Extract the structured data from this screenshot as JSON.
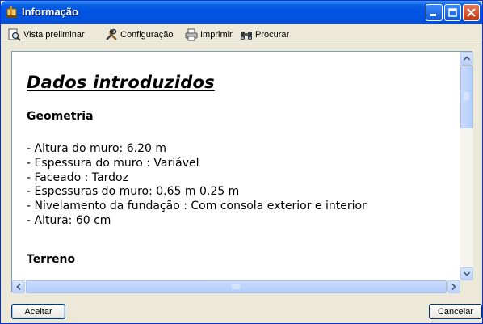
{
  "window": {
    "title": "Informação"
  },
  "toolbar": {
    "items": [
      {
        "label": "Vista preliminar",
        "icon": "magnifier-page-icon"
      },
      {
        "label": "Configuração",
        "icon": "tools-icon"
      },
      {
        "label": "Imprimir",
        "icon": "printer-icon"
      },
      {
        "label": "Procurar",
        "icon": "binoculars-icon"
      }
    ]
  },
  "document": {
    "title": "Dados introduzidos",
    "section_geometry": "Geometria",
    "lines": [
      "- Altura do muro: 6.20 m",
      "- Espessura do muro : Variável",
      "- Faceado : Tardoz",
      "- Espessuras do muro: 0.65 m 0.25 m",
      "- Nivelamento da fundação : Com consola exterior e interior",
      "- Altura: 60 cm"
    ],
    "section_terrain": "Terreno"
  },
  "buttons": {
    "ok": "Aceitar",
    "cancel": "Cancelar"
  },
  "colors": {
    "titlebar": "#0054e3",
    "accent_border": "#0831d9",
    "window_bg": "#ece9d8"
  }
}
